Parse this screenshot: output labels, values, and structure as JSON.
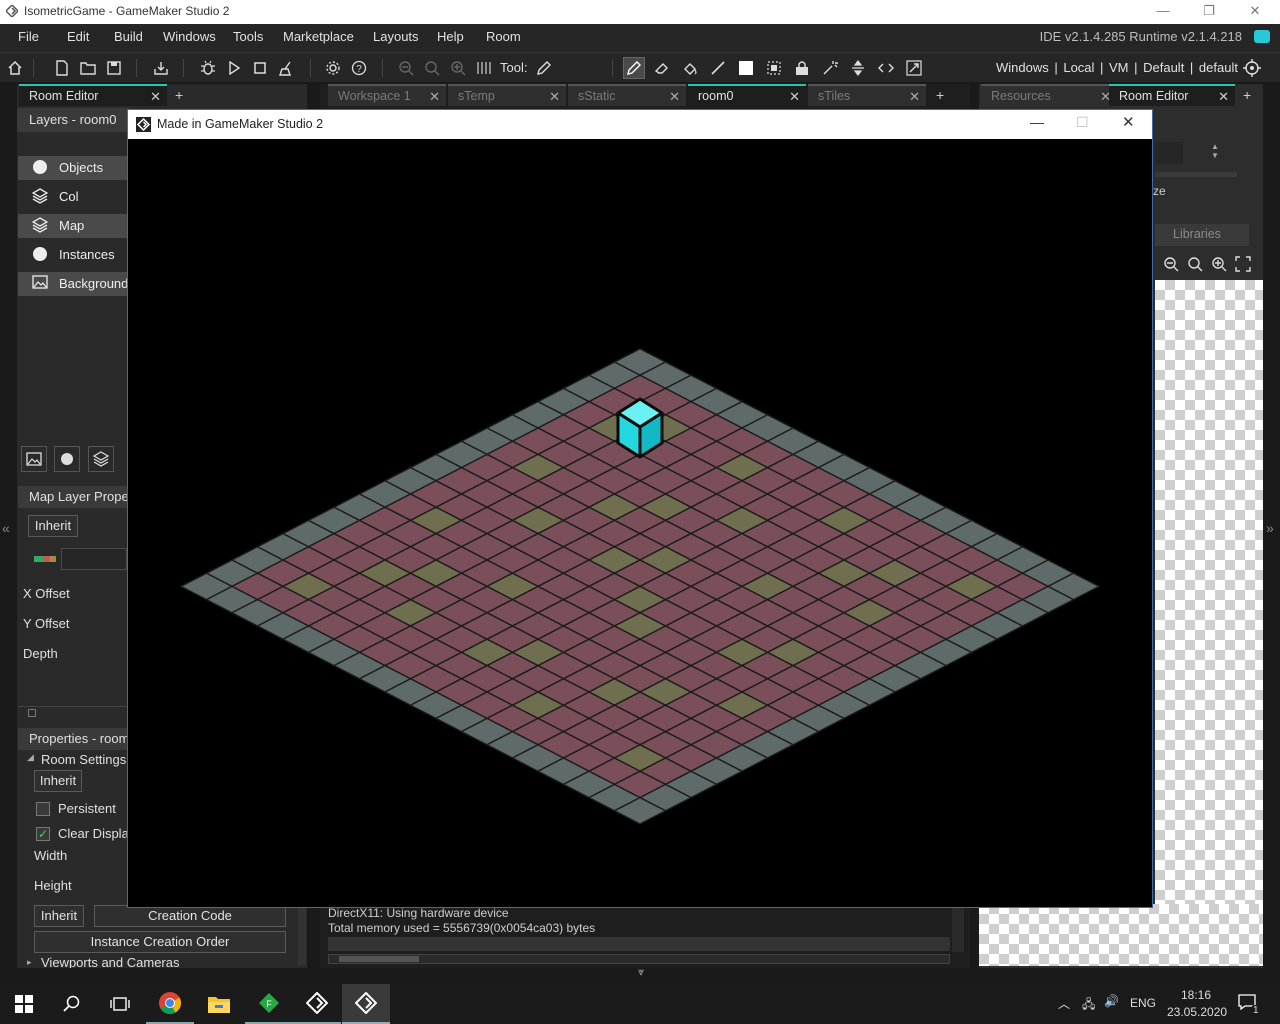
{
  "window": {
    "title": "IsometricGame - GameMaker Studio 2",
    "controls": [
      "—",
      "❐",
      "✕"
    ]
  },
  "menu": {
    "items": [
      "File",
      "Edit",
      "Build",
      "Windows",
      "Tools",
      "Marketplace",
      "Layouts",
      "Help",
      "Room"
    ],
    "ide_version": "IDE v2.1.4.285 Runtime v2.1.4.218"
  },
  "toolbar": {
    "tool_label": "Tool:",
    "target": "Windows  |  Local  |  VM  |  Default  |  default"
  },
  "left_panel": {
    "tab": "Room Editor",
    "layers_title": "Layers - room0",
    "layers": [
      {
        "name": "Objects",
        "icon": "instance-icon",
        "selected": true
      },
      {
        "name": "Col",
        "icon": "tile-icon",
        "selected": false
      },
      {
        "name": "Map",
        "icon": "tile-icon",
        "selected": true
      },
      {
        "name": "Instances",
        "icon": "instance-icon",
        "selected": false
      },
      {
        "name": "Background",
        "icon": "background-icon",
        "selected": true
      }
    ],
    "map_layer_title": "Map Layer Proper",
    "inherit_label": "Inherit",
    "x_offset": "X Offset",
    "y_offset": "Y Offset",
    "depth": "Depth",
    "properties_title": "Properties - room",
    "room_settings": "Room Settings",
    "room_inherit": "Inherit",
    "persistent": "Persistent",
    "persistent_checked": false,
    "clear_display": "Clear Display",
    "clear_display_checked": true,
    "width": "Width",
    "height": "Height",
    "inherit_btn": "Inherit",
    "creation_code": "Creation Code",
    "instance_creation_order": "Instance Creation Order",
    "viewports": "Viewports and Cameras"
  },
  "center_tabs": [
    {
      "label": "Workspace 1",
      "active": false
    },
    {
      "label": "sTemp",
      "active": false
    },
    {
      "label": "sStatic",
      "active": false
    },
    {
      "label": "room0",
      "active": true
    },
    {
      "label": "sTiles",
      "active": false
    }
  ],
  "output": {
    "line1": "DirectX11: Using hardware device",
    "line2": "Total memory used = 5556739(0x0054ca03) bytes"
  },
  "right_panel": {
    "tabs": [
      {
        "label": "Resources",
        "active": false
      },
      {
        "label": "Room Editor",
        "active": true
      }
    ],
    "libraries": "Libraries",
    "partial_text": "ze"
  },
  "game_window": {
    "title": "Made in GameMaker Studio 2",
    "grid_size": 18,
    "colors": {
      "background": "#000000",
      "border_tile": "#5f6b6b",
      "floor_red": "#7a4f5a",
      "floor_olive": "#6f6f4f",
      "cube_top": "#6af0f0",
      "cube_left": "#25d8e0",
      "cube_right": "#12b8c4"
    }
  },
  "taskbar": {
    "lang": "ENG",
    "time": "18:16",
    "date": "23.05.2020",
    "notifications": "1"
  }
}
